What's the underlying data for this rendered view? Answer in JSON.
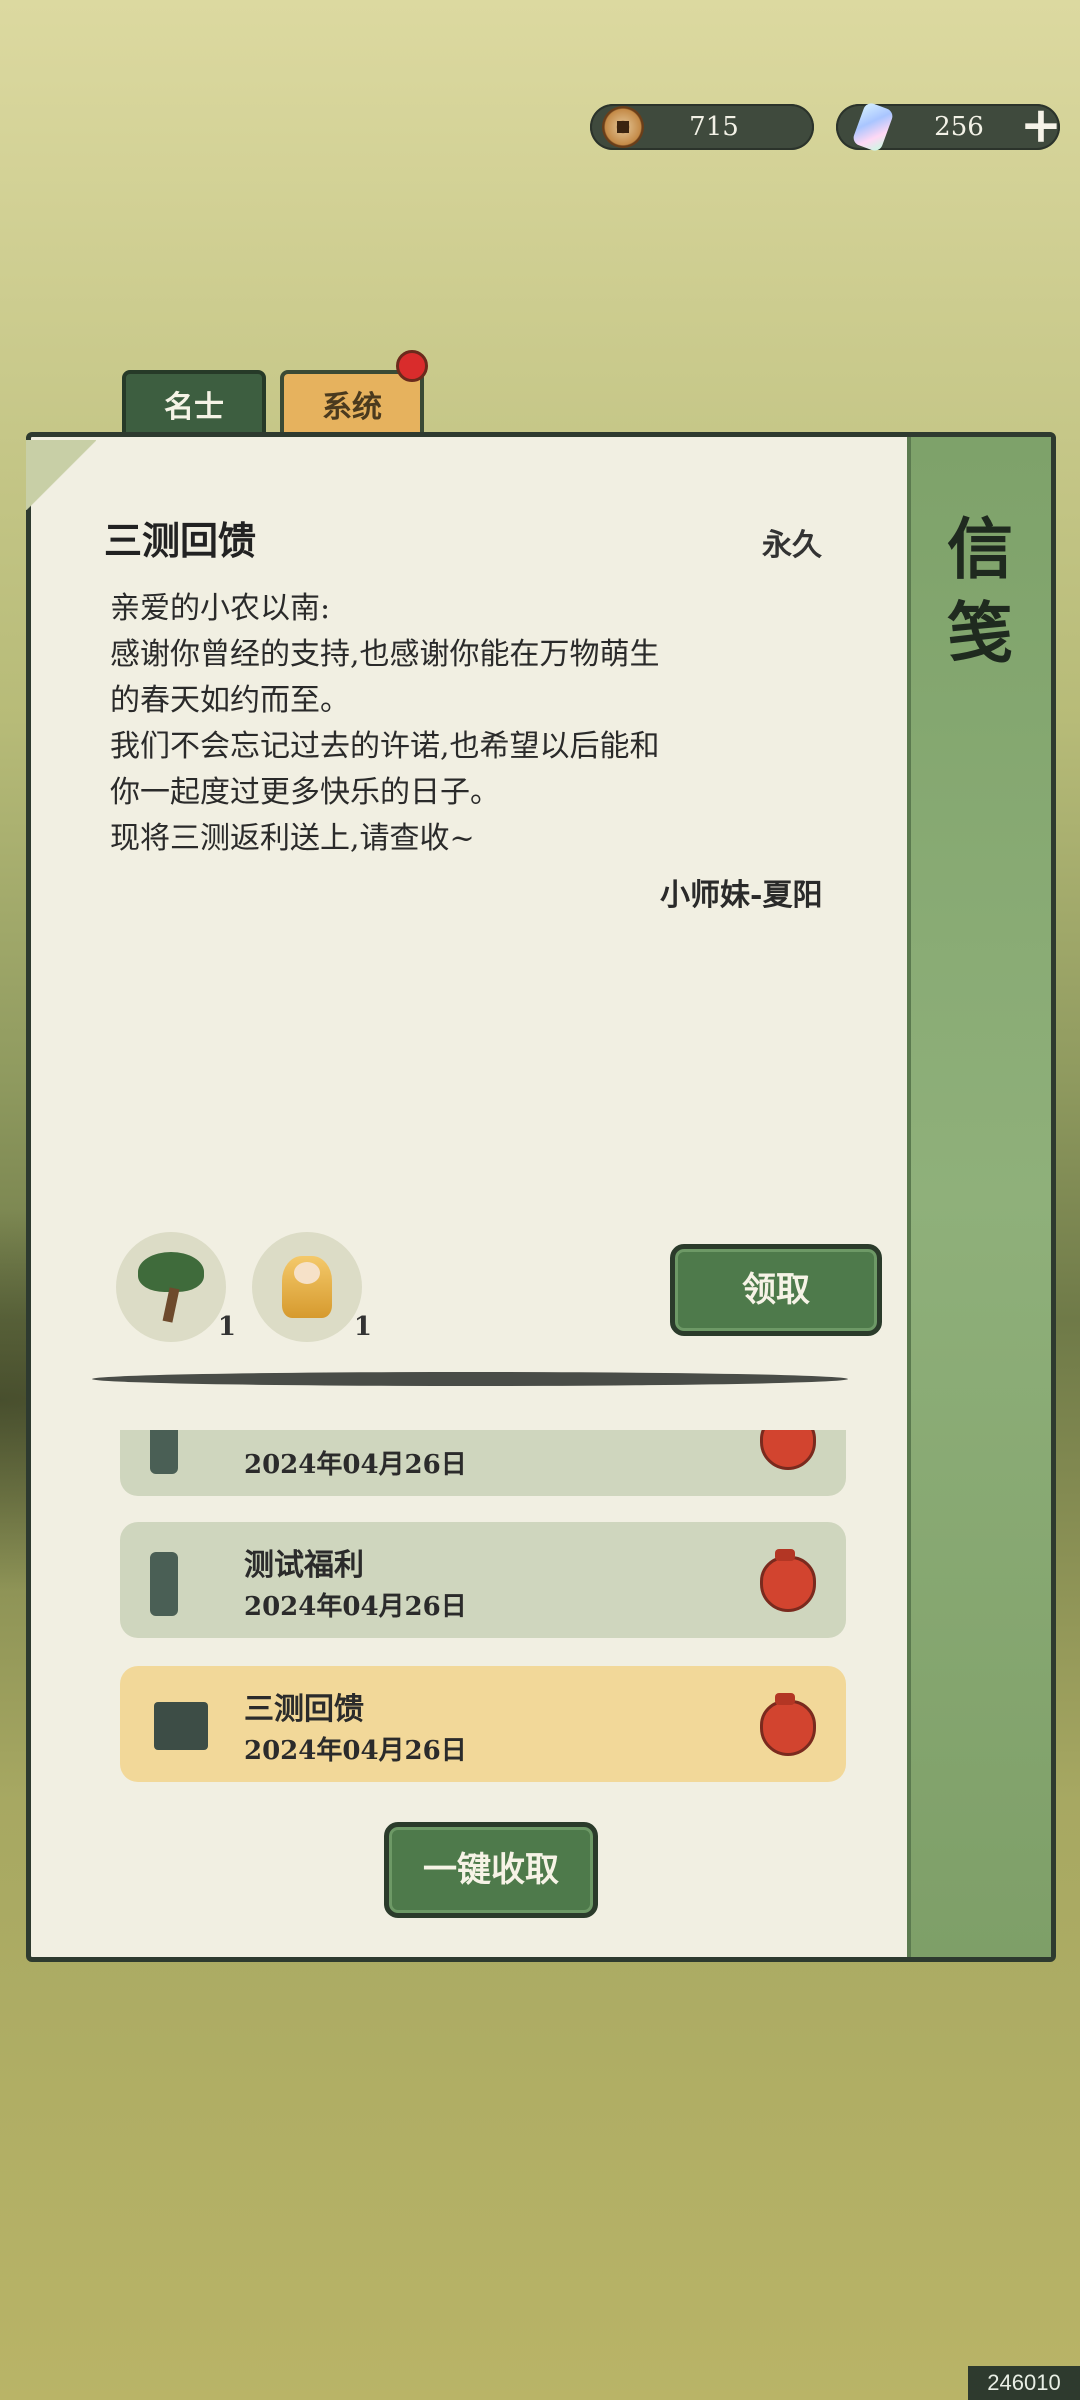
{
  "currency": {
    "coins": "715",
    "gems": "256",
    "coin_icon": "copper-coin-icon",
    "gem_icon": "crystal-gem-icon",
    "add_icon": "plus-icon"
  },
  "tabs": [
    {
      "label": "名士",
      "active": false
    },
    {
      "label": "系统",
      "active": true,
      "has_badge": true
    }
  ],
  "panel_title": "信笺",
  "mail": {
    "title": "三测回馈",
    "duration": "永久",
    "body_lines": [
      "亲爱的小农以南:",
      "感谢你曾经的支持,也感谢你能在万物萌生",
      "的春天如约而至。",
      "我们不会忘记过去的许诺,也希望以后能和",
      "你一起度过更多快乐的日子。",
      "现将三测返利送上,请查收~"
    ],
    "signature": "小师妹-夏阳",
    "rewards": [
      {
        "icon": "bonsai-tree-icon",
        "count": "1"
      },
      {
        "icon": "character-portrait-icon",
        "count": "1"
      }
    ],
    "claim_label": "领取"
  },
  "mail_list": [
    {
      "name": "",
      "date": "2024年04月26日",
      "state": "read",
      "icon": "scroll-icon"
    },
    {
      "name": "测试福利",
      "date": "2024年04月26日",
      "state": "read",
      "icon": "scroll-icon"
    },
    {
      "name": "三测回馈",
      "date": "2024年04月26日",
      "state": "active",
      "icon": "open-scroll-icon"
    }
  ],
  "claim_all_label": "一键收取",
  "watermark": "246010",
  "colors": {
    "accent_green": "#4e7a4b",
    "tab_orange": "#e6b25e",
    "badge_red": "#d92c2c",
    "active_item": "#f2d899"
  }
}
